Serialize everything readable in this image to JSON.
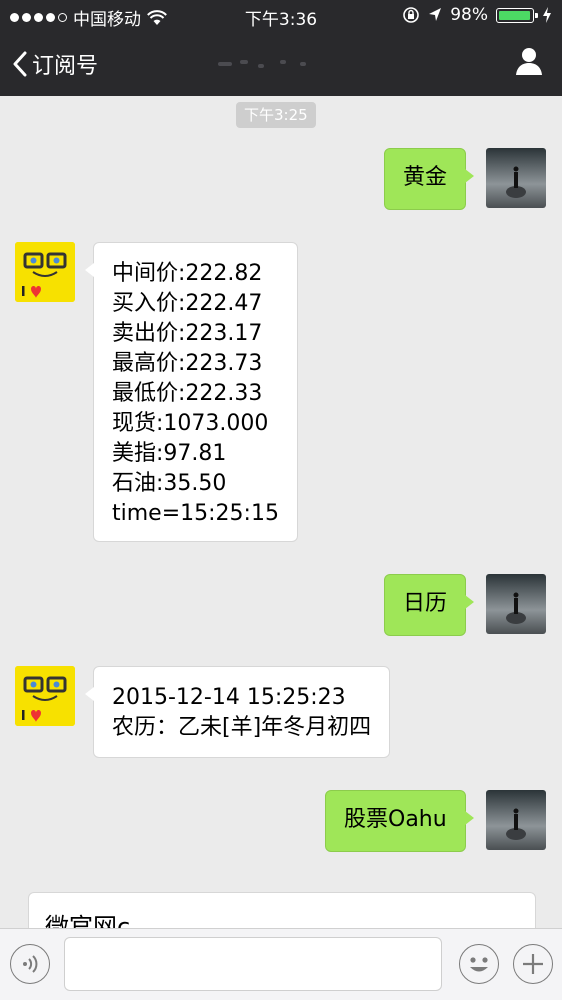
{
  "status_bar": {
    "carrier": "中国移动",
    "time": "下午3:36",
    "battery_percent": "98%",
    "battery_level": 0.98,
    "signal_bars_filled": 4,
    "icons": [
      "wifi-icon",
      "orientation-lock-icon",
      "location-icon",
      "battery-icon",
      "charging-icon"
    ]
  },
  "nav": {
    "back_label": "订阅号",
    "icons": [
      "chevron-left-icon",
      "person-icon"
    ]
  },
  "chat": {
    "timestamp": "下午3:25",
    "messages": [
      {
        "direction": "out",
        "lines": [
          "黄金"
        ]
      },
      {
        "direction": "in",
        "lines": [
          "中间价:222.82",
          "买入价:222.47",
          "卖出价:223.17",
          "最高价:223.73",
          "最低价:222.33",
          "现货:1073.000",
          "美指:97.81",
          "石油:35.50",
          "time=15:25:15"
        ]
      },
      {
        "direction": "out",
        "lines": [
          "日历"
        ]
      },
      {
        "direction": "in",
        "lines": [
          "2015-12-14 15:25:23",
          "农历：乙未[羊]年冬月初四"
        ]
      },
      {
        "direction": "out",
        "lines": [
          "股票Oahu"
        ]
      }
    ],
    "partial_card_text": "微官网c..."
  },
  "colors": {
    "header_bg": "#29292c",
    "chat_bg": "#ebebeb",
    "out_bubble": "#9fe658",
    "in_bubble": "#ffffff",
    "battery_green": "#4cd964"
  },
  "input_bar": {
    "value": "",
    "icons": [
      "voice-icon",
      "emoji-icon",
      "plus-icon"
    ]
  }
}
